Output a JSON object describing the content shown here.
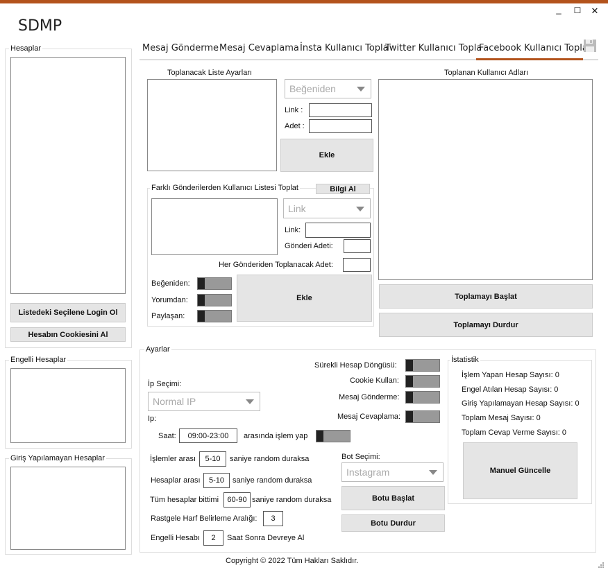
{
  "app": {
    "title": "SDMP",
    "window": {
      "minimize": "_",
      "maximize": "☐",
      "close": "✕"
    }
  },
  "tabs": [
    {
      "label": "Mesaj Gönderme",
      "active": false
    },
    {
      "label": "Mesaj Cevaplama",
      "active": false
    },
    {
      "label": "İnsta Kullanıcı Topla",
      "active": false
    },
    {
      "label": "Twitter Kullanıcı Topla",
      "active": false
    },
    {
      "label": "Facebook Kullanıcı Topla",
      "active": true
    }
  ],
  "colors": {
    "accent": "#b3531c"
  },
  "left": {
    "hesaplar": "Hesaplar",
    "login_button": "Listedeki Seçilene Login Ol",
    "cookie_button": "Hesabın Cookiesini Al",
    "engelli": "Engelli Hesaplar",
    "giris": "Giriş Yapılamayan Hesaplar"
  },
  "fb": {
    "liste_ayarlari": "Toplanacak Liste Ayarları",
    "combo1": "Beğeniden",
    "link_label": "Link :",
    "adet_label": "Adet :",
    "ekle1": "Ekle",
    "farkli": "Farklı Gönderilerden Kullanıcı Listesi Toplat",
    "bilgi_al": "Bilgi Al",
    "combo2": "Link",
    "link2_label": "Link:",
    "gonderi_adeti": "Gönderi Adeti:",
    "her_gonderiden": "Her Gönderiden Toplanacak Adet:",
    "begeniden": "Beğeniden:",
    "yorumdan": "Yorumdan:",
    "paylasan": "Paylaşan:",
    "ekle2": "Ekle",
    "toplanan": "Toplanan Kullanıcı Adları",
    "baslat": "Toplamayı Başlat",
    "durdur": "Toplamayı Durdur"
  },
  "ayarlar": {
    "title": "Ayarlar",
    "ip_secimi": "İp Seçimi:",
    "ip_combo": "Normal IP",
    "ip": "Ip:",
    "saat": "Saat:",
    "saat_value": "09:00-23:00",
    "arasinda": "arasında işlem yap",
    "surekli": "Sürekli Hesap Döngüsü:",
    "cookie": "Cookie Kullan:",
    "mesaj_gonderme": "Mesaj Gönderme:",
    "mesaj_cevaplama": "Mesaj Cevaplama:",
    "islemler_arasi": "İşlemler arası",
    "islemler_value": "5-10",
    "saniye1": "saniye random duraksa",
    "hesaplar_arasi": "Hesaplar arası",
    "hesaplar_value": "5-10",
    "saniye2": "saniye random duraksa",
    "tum_hesaplar": "Tüm hesaplar bittimi",
    "tum_value": "60-90",
    "saniye3": "saniye random duraksa",
    "rastgele": "Rastgele Harf Belirleme Aralığı:",
    "rastgele_value": "3",
    "engelli_hesabi": "Engelli Hesabı",
    "engelli_value": "2",
    "saat_sonra": "Saat Sonra Devreye Al",
    "bot_secimi": "Bot Seçimi:",
    "bot_combo": "Instagram",
    "botu_baslat": "Botu Başlat",
    "botu_durdur": "Botu Durdur"
  },
  "istatistik": {
    "title": "İstatistik",
    "islem_yapan": "İşlem Yapan Hesap Sayısı: 0",
    "engel_atilan": "Engel Atılan Hesap Sayısı: 0",
    "giris_yapilamayan": "Giriş Yapılamayan Hesap Sayısı: 0",
    "toplam_mesaj": "Toplam Mesaj Sayısı: 0",
    "toplam_cevap": "Toplam Cevap Verme Sayısı: 0",
    "manuel": "Manuel Güncelle"
  },
  "footer": {
    "copyright": "Copyright © 2022 Tüm Hakları Saklıdır."
  }
}
